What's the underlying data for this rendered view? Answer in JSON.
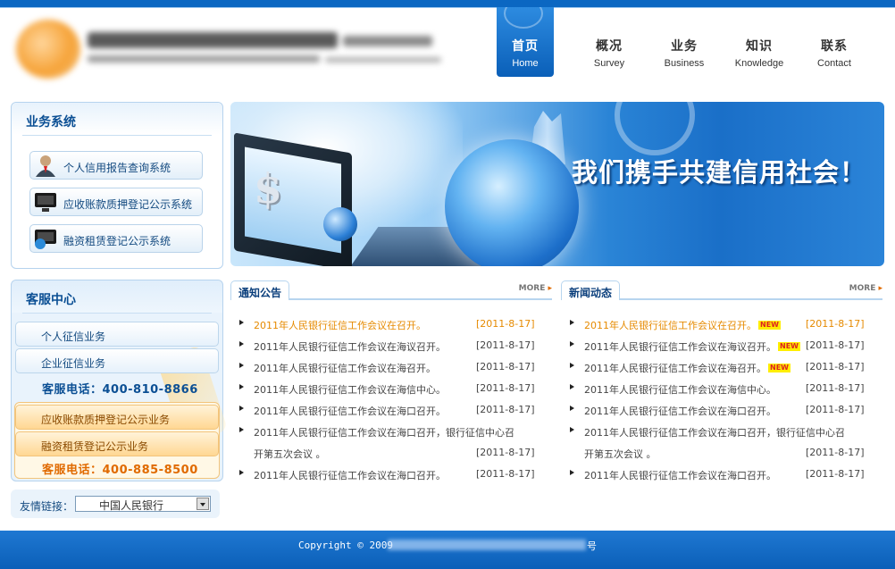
{
  "nav": [
    {
      "zh": "首页",
      "en": "Home",
      "active": true
    },
    {
      "zh": "概况",
      "en": "Survey"
    },
    {
      "zh": "业务",
      "en": "Business"
    },
    {
      "zh": "知识",
      "en": "Knowledge"
    },
    {
      "zh": "联系",
      "en": "Contact"
    }
  ],
  "business": {
    "title": "业务系统",
    "items": [
      {
        "label": "个人信用报告查询系统",
        "icon": "person-icon"
      },
      {
        "label": "应收账款质押登记公示系统",
        "icon": "monitor-icon"
      },
      {
        "label": "融资租赁登记公示系统",
        "icon": "monitor-globe-icon"
      }
    ]
  },
  "service": {
    "title": "客服中心",
    "blue_items": [
      "个人征信业务",
      "企业征信业务"
    ],
    "blue_hotline": "客服电话：400-810-8866",
    "orange_items": [
      "应收账款质押登记公示业务",
      "融资租赁登记公示业务"
    ],
    "orange_hotline": "客服电话：400-885-8500"
  },
  "links": {
    "label": "友情链接：",
    "selected": "中国人民银行"
  },
  "banner": {
    "slogan": "我们携手共建信用社会！"
  },
  "notice": {
    "title": "通知公告",
    "more": "MORE",
    "rows": [
      {
        "title": "2011年人民银行征信工作会议在召开。",
        "date": "[2011-8-17]",
        "hot": true
      },
      {
        "title": "2011年人民银行征信工作会议在海议召开。",
        "date": "[2011-8-17]"
      },
      {
        "title": "2011年人民银行征信工作会议在海召开。",
        "date": "[2011-8-17]"
      },
      {
        "title": "2011年人民银行征信工作会议在海信中心。",
        "date": "[2011-8-17]"
      },
      {
        "title": "2011年人民银行征信工作会议在海口召开。",
        "date": "[2011-8-17]"
      },
      {
        "title": "2011年人民银行征信工作会议在海口召开，银行征信中心召",
        "title2": "开第五次会议 。",
        "date": "[2011-8-17]"
      },
      {
        "title": "2011年人民银行征信工作会议在海口召开。",
        "date": "[2011-8-17]"
      }
    ]
  },
  "news": {
    "title": "新闻动态",
    "more": "MORE",
    "badge": "NEW",
    "rows": [
      {
        "title": "2011年人民银行征信工作会议在召开。",
        "date": "[2011-8-17]",
        "hot": true,
        "new": true
      },
      {
        "title": "2011年人民银行征信工作会议在海议召开。",
        "date": "[2011-8-17]",
        "new": true
      },
      {
        "title": "2011年人民银行征信工作会议在海召开。",
        "date": "[2011-8-17]",
        "new": true
      },
      {
        "title": "2011年人民银行征信工作会议在海信中心。",
        "date": "[2011-8-17]"
      },
      {
        "title": "2011年人民银行征信工作会议在海口召开。",
        "date": "[2011-8-17]"
      },
      {
        "title": "2011年人民银行征信工作会议在海口召开，银行征信中心召",
        "title2": "开第五次会议 。",
        "date": "[2011-8-17]"
      },
      {
        "title": "2011年人民银行征信工作会议在海口召开。",
        "date": "[2011-8-17]"
      }
    ]
  },
  "footer": {
    "copyright": "Copyright © 2009",
    "suffix": "号"
  }
}
